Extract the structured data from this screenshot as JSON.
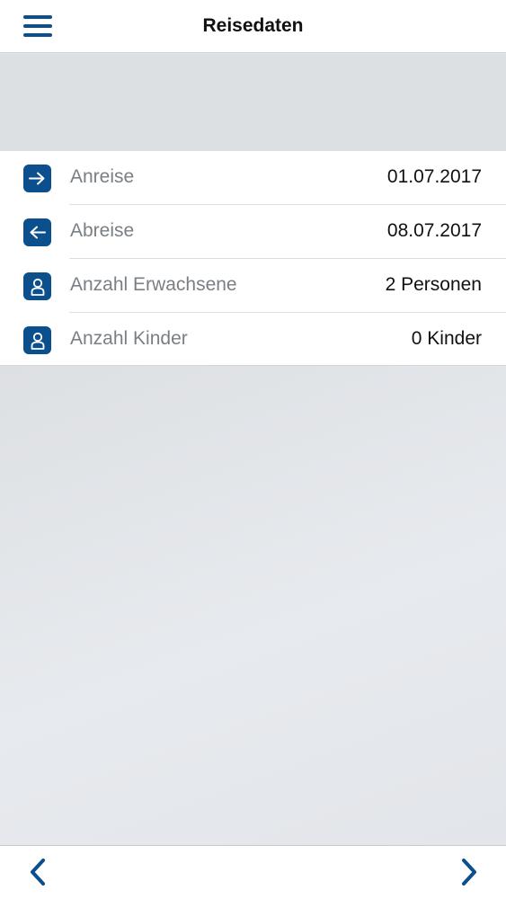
{
  "header": {
    "title": "Reisedaten"
  },
  "travel": {
    "rows": [
      {
        "label": "Anreise",
        "value": "01.07.2017",
        "icon": "arrow-right-icon"
      },
      {
        "label": "Abreise",
        "value": "08.07.2017",
        "icon": "arrow-left-icon"
      },
      {
        "label": "Anzahl Erwachsene",
        "value": "2 Personen",
        "icon": "person-icon"
      },
      {
        "label": "Anzahl Kinder",
        "value": "0 Kinder",
        "icon": "person-icon"
      }
    ]
  },
  "footer": {
    "back_icon": "chevron-left-icon",
    "forward_icon": "chevron-right-icon"
  },
  "colors": {
    "accent": "#0b4f8c",
    "background": "#e3e6e9"
  }
}
